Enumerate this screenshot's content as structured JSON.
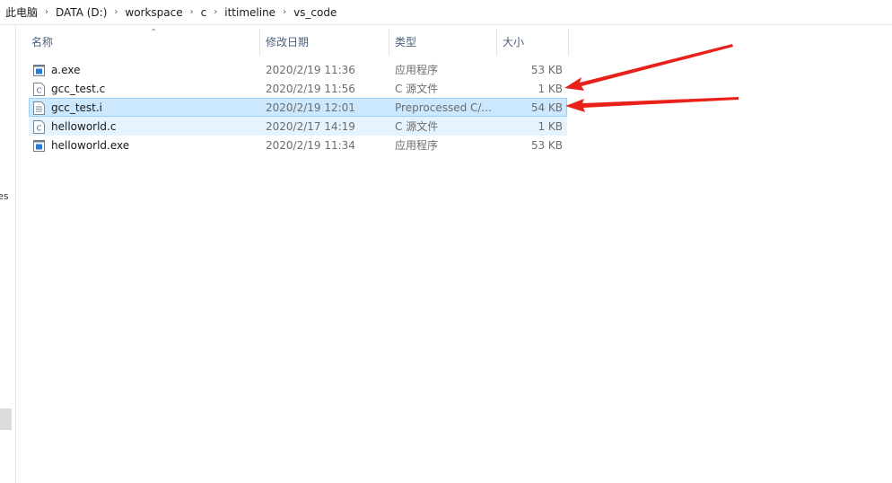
{
  "breadcrumb": [
    "此电脑",
    "DATA (D:)",
    "workspace",
    "c",
    "ittimeline",
    "vs_code"
  ],
  "sidebar": {
    "partial_text": "les"
  },
  "columns": {
    "name": "名称",
    "date": "修改日期",
    "type": "类型",
    "size": "大小"
  },
  "files": [
    {
      "name": "a.exe",
      "date": "2020/2/19 11:36",
      "type": "应用程序",
      "size": "53 KB",
      "icon": "exe-icon"
    },
    {
      "name": "gcc_test.c",
      "date": "2020/2/19 11:56",
      "type": "C 源文件",
      "size": "1 KB",
      "icon": "c-file-icon"
    },
    {
      "name": "gcc_test.i",
      "date": "2020/2/19 12:01",
      "type": "Preprocessed C/...",
      "size": "54 KB",
      "icon": "text-file-icon"
    },
    {
      "name": "helloworld.c",
      "date": "2020/2/17 14:19",
      "type": "C 源文件",
      "size": "1 KB",
      "icon": "c-file-icon"
    },
    {
      "name": "helloworld.exe",
      "date": "2020/2/19 11:34",
      "type": "应用程序",
      "size": "53 KB",
      "icon": "exe-icon"
    }
  ],
  "colors": {
    "selected": "#cce8ff",
    "hover": "#e5f3ff",
    "annotation_arrow": "#e8211b"
  }
}
